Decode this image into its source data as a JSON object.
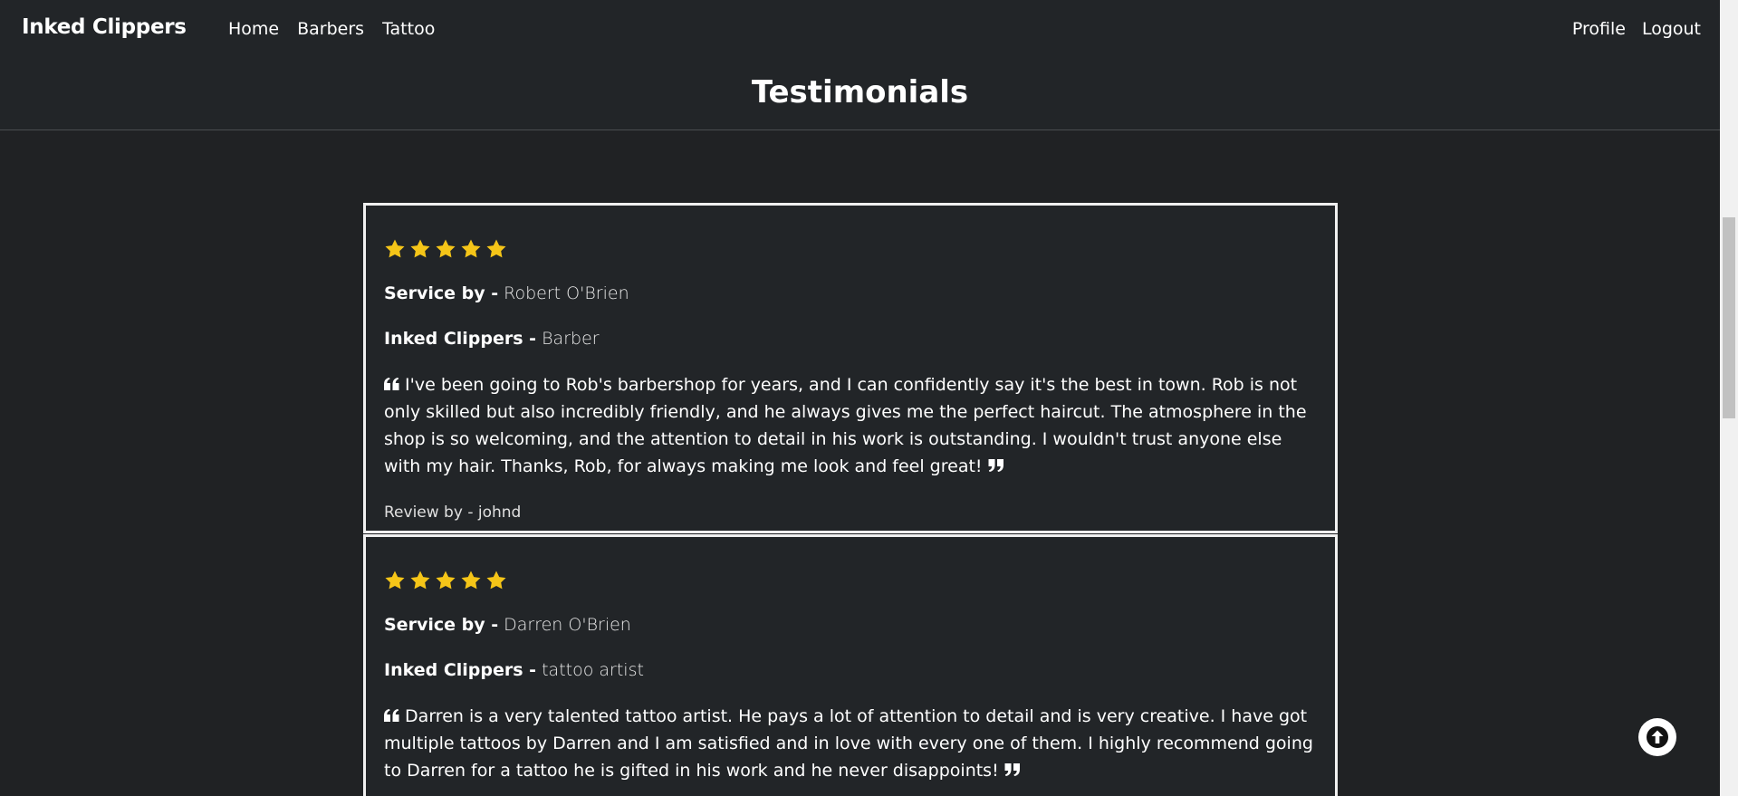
{
  "navbar": {
    "brand": "Inked Clippers",
    "left_links": [
      "Home",
      "Barbers",
      "Tattoo"
    ],
    "right_links": [
      "Profile",
      "Logout"
    ]
  },
  "page": {
    "title": "Testimonials"
  },
  "testimonials": [
    {
      "rating": 5,
      "service_label": "Service by -",
      "service_by": "Robert O'Brien",
      "shop_label": "Inked Clippers -",
      "role": "Barber",
      "quote": "I've been going to Rob's barbershop for years, and I can confidently say it's the best in town. Rob is not only skilled but also incredibly friendly, and he always gives me the perfect haircut. The atmosphere in the shop is so welcoming, and the attention to detail in his work is outstanding. I wouldn't trust anyone else with my hair. Thanks, Rob, for always making me look and feel great!",
      "review_by": "Review by - johnd"
    },
    {
      "rating": 5,
      "service_label": "Service by -",
      "service_by": "Darren O'Brien",
      "shop_label": "Inked Clippers -",
      "role": "tattoo artist",
      "quote": "Darren is a very talented tattoo artist. He pays a lot of attention to detail and is very creative. I have got multiple tattoos by Darren and I am satisfied and in love with every one of them. I highly recommend going to Darren for a tattoo he is gifted in his work and he never disappoints!"
    }
  ],
  "icons": {
    "star": "star-icon",
    "quote_left": "quote-left-icon",
    "quote_right": "quote-right-icon",
    "back_to_top": "arrow-up-circle-icon"
  },
  "colors": {
    "background": "#202224",
    "navbar": "#222528",
    "star": "#f5c518",
    "card_border": "#f0f0f0"
  }
}
